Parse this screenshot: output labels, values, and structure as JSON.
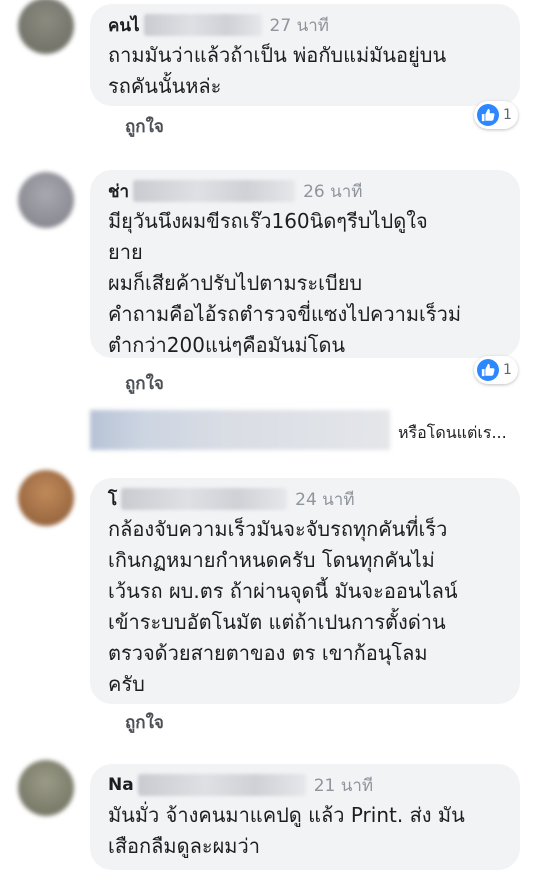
{
  "comments": [
    {
      "name": "คนไ",
      "time": "27 นาที",
      "text": "ถามมันว่าแล้วถ้าเป็น พ่อกับแม่มันอยู่บน\nรถคันนั้นหล่ะ",
      "like_label": "ถูกใจ",
      "reaction_count": "1"
    },
    {
      "name": "ช่า",
      "time": "26 นาที",
      "text": "มียุวันนึงผมขีรถเร๊ว160นิดๆรีบไปดูใจ\nยาย\nผมก็เสียค้าปรับไปตามระเบียบ\nคำถามคือไอ้รถตำรวจขี่แซงไปความเร็วม่\nตำกว่า200แน่ๆคือมันม่โดน",
      "like_label": "ถูกใจ",
      "reaction_count": "1"
    },
    {
      "name": "โ",
      "time": "24 นาที",
      "text": "กล้องจับความเร็วมันจะจับรถทุกคันที่เร็ว\nเกินกฏหมายกำหนดครับ โดนทุกคันไม่\nเว้นรถ ผบ.ตร ถ้าผ่านจุดนี้ มันจะออนไลน์\nเข้าระบบอัตโนมัต แต่ถ้าเปนการตั้งด่าน\nตรวจด้วยสายตาของ ตร เขาก้อนุโลม\nครับ",
      "like_label": "ถูกใจ"
    },
    {
      "name": "Na",
      "time": "21 นาที",
      "text": "มันมั่ว จ้างคนมาแคปดู แล้ว Print. ส่ง มัน\nเสือกลืมดูละผมว่า"
    }
  ],
  "reply_preview": {
    "text": "หรือโดนแต่เร..."
  },
  "colors": {
    "bubble": "#f2f3f5",
    "time": "#90949c",
    "like_blue": "#2d88ff"
  }
}
